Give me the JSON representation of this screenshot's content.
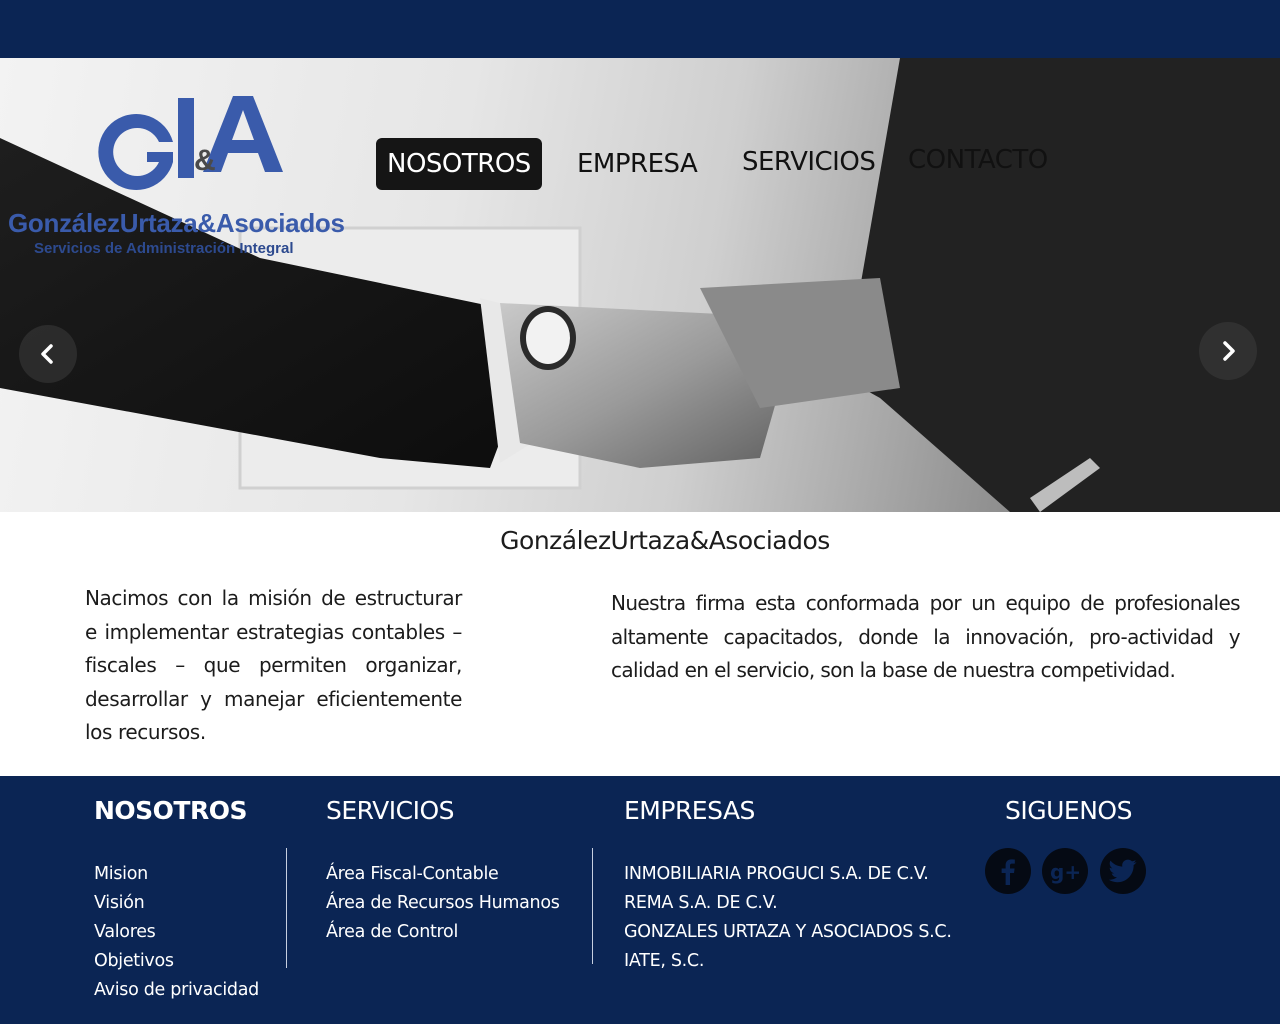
{
  "logo": {
    "monogram": "G&A",
    "name": "GonzálezUrtaza&Asociados",
    "tagline": "Servicios de Administración Integral"
  },
  "nav": {
    "items": [
      {
        "label": "NOSOTROS",
        "active": true
      },
      {
        "label": "EMPRESA",
        "active": false
      },
      {
        "label": "SERVICIOS",
        "active": false
      },
      {
        "label": "CONTACTO",
        "active": false
      }
    ]
  },
  "carousel": {
    "prev_icon": "chevron-left-icon",
    "next_icon": "chevron-right-icon"
  },
  "intro": {
    "title": "GonzálezUrtaza&Asociados",
    "left_text": "Nacimos con la misión de estructurar e implementar estrategias contables – fiscales – que permiten organizar, desarrollar y manejar eficientemente los recursos.",
    "right_text": "Nuestra firma esta conformada por un equipo de profesionales altamente capacitados, donde la innovación, pro-actividad y calidad en el servicio, son la base de nuestra competividad."
  },
  "footer": {
    "nosotros": {
      "heading": "NOSOTROS",
      "links": [
        "Mision",
        "Visión",
        "Valores",
        "Objetivos",
        "Aviso de privacidad"
      ]
    },
    "servicios": {
      "heading": "SERVICIOS",
      "links": [
        "Área Fiscal-Contable",
        "Área de Recursos Humanos",
        "Área de Control"
      ]
    },
    "empresas": {
      "heading": "EMPRESAS",
      "links": [
        "INMOBILIARIA PROGUCI S.A. DE C.V.",
        "REMA S.A. DE C.V.",
        "GONZALES URTAZA Y ASOCIADOS S.C.",
        "IATE, S.C."
      ]
    },
    "social": {
      "heading": "SIGUENOS",
      "icons": [
        "facebook-icon",
        "google-plus-icon",
        "twitter-icon"
      ]
    }
  },
  "colors": {
    "navy": "#0b2554",
    "logo_blue": "#3a5bab",
    "nav_active_bg": "#151515"
  }
}
